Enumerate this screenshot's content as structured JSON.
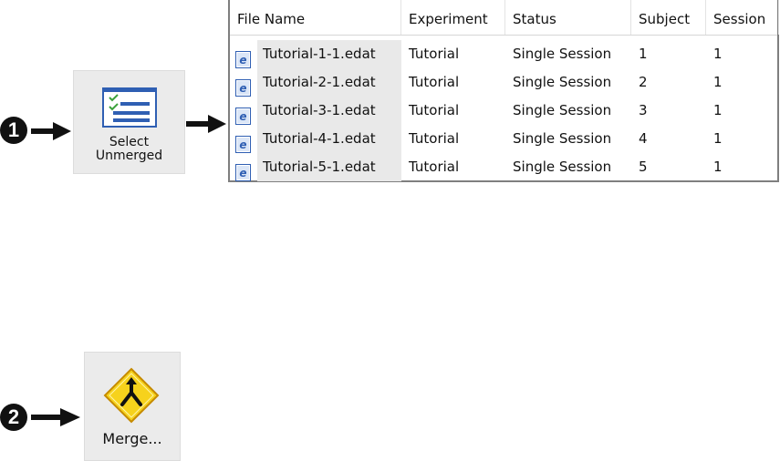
{
  "steps": {
    "step1": "1",
    "step2": "2"
  },
  "select_unmerged_button": {
    "label_line1": "Select",
    "label_line2": "Unmerged",
    "icon": "checklist-icon"
  },
  "merge_button": {
    "label": "Merge...",
    "icon": "merge-arrows-icon"
  },
  "file_list": {
    "columns": [
      "File Name",
      "Experiment",
      "Status",
      "Subject",
      "Session"
    ],
    "rows": [
      {
        "file": "Tutorial-1-1.edat",
        "experiment": "Tutorial",
        "status": "Single Session",
        "subject": "1",
        "session": "1"
      },
      {
        "file": "Tutorial-2-1.edat",
        "experiment": "Tutorial",
        "status": "Single Session",
        "subject": "2",
        "session": "1"
      },
      {
        "file": "Tutorial-3-1.edat",
        "experiment": "Tutorial",
        "status": "Single Session",
        "subject": "3",
        "session": "1"
      },
      {
        "file": "Tutorial-4-1.edat",
        "experiment": "Tutorial",
        "status": "Single Session",
        "subject": "4",
        "session": "1"
      },
      {
        "file": "Tutorial-5-1.edat",
        "experiment": "Tutorial",
        "status": "Single Session",
        "subject": "5",
        "session": "1"
      }
    ],
    "row_icon": "edat-file-icon"
  },
  "colors": {
    "badge": "#111111",
    "button_bg": "#ebebeb",
    "merge_diamond": "#f6d21c",
    "list_icon_blue": "#2f5fb3"
  }
}
